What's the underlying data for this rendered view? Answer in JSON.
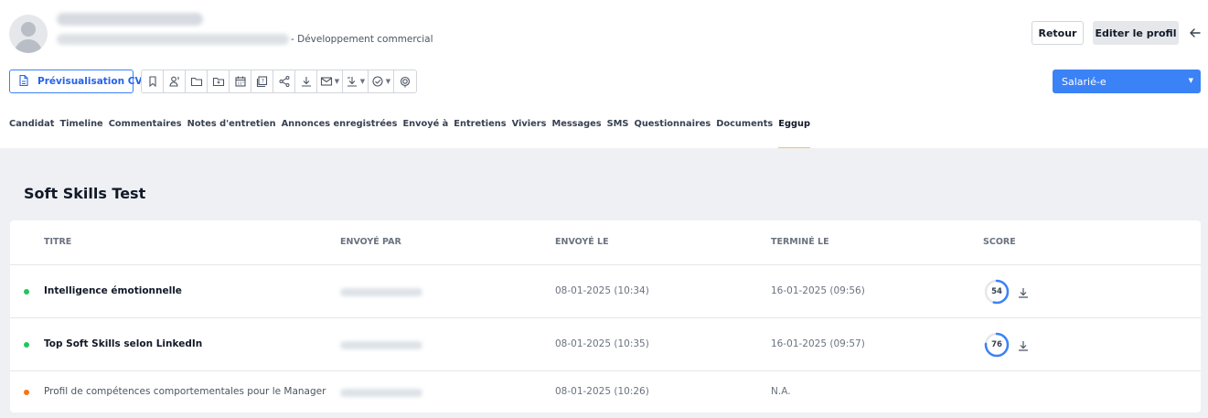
{
  "header": {
    "department": "- Développement commercial",
    "retour_label": "Retour",
    "edit_label": "Editer le profil"
  },
  "toolbar": {
    "cv_label": "Prévisualisation CV",
    "buttons": [
      {
        "icon": "bookmark-icon"
      },
      {
        "icon": "user-assign-icon"
      },
      {
        "icon": "folder-icon"
      },
      {
        "icon": "folder-add-icon"
      },
      {
        "icon": "calendar-icon"
      },
      {
        "icon": "question-card-icon"
      },
      {
        "icon": "share-icon"
      },
      {
        "icon": "download-icon"
      },
      {
        "icon": "mail-icon",
        "dropdown": true
      },
      {
        "icon": "export-icon",
        "dropdown": true
      },
      {
        "icon": "check-circle-icon",
        "dropdown": true
      },
      {
        "icon": "fingerprint-icon"
      }
    ]
  },
  "status": {
    "value": "Salarié-e"
  },
  "tabs": [
    "Candidat",
    "Timeline",
    "Commentaires",
    "Notes d'entretien",
    "Annonces enregistrées",
    "Envoyé à",
    "Entretiens",
    "Viviers",
    "Messages",
    "SMS",
    "Questionnaires",
    "Documents",
    "Eggup"
  ],
  "active_tab": "Eggup",
  "section": {
    "title": "Soft Skills Test"
  },
  "table": {
    "headers": [
      "TITRE",
      "ENVOYÉ PAR",
      "ENVOYÉ LE",
      "TERMINÉ LE",
      "SCORE"
    ],
    "rows": [
      {
        "title": "Intelligence émotionnelle",
        "sent_on": "08-01-2025 (10:34)",
        "finished_on": "16-01-2025 (09:56)",
        "score": "54",
        "score_pct": 54,
        "status_color": "#22c55e",
        "bold": true
      },
      {
        "title": "Top Soft Skills selon LinkedIn",
        "sent_on": "08-01-2025 (10:35)",
        "finished_on": "16-01-2025 (09:57)",
        "score": "76",
        "score_pct": 76,
        "status_color": "#22c55e",
        "bold": true
      },
      {
        "title": "Profil de compétences comportementales pour le Manager",
        "sent_on": "08-01-2025 (10:26)",
        "finished_on": "N.A.",
        "score": "",
        "score_pct": null,
        "status_color": "#f97316",
        "bold": false
      }
    ]
  },
  "colors": {
    "accent": "#3b82f6",
    "tab_underline": "#f6c452"
  }
}
